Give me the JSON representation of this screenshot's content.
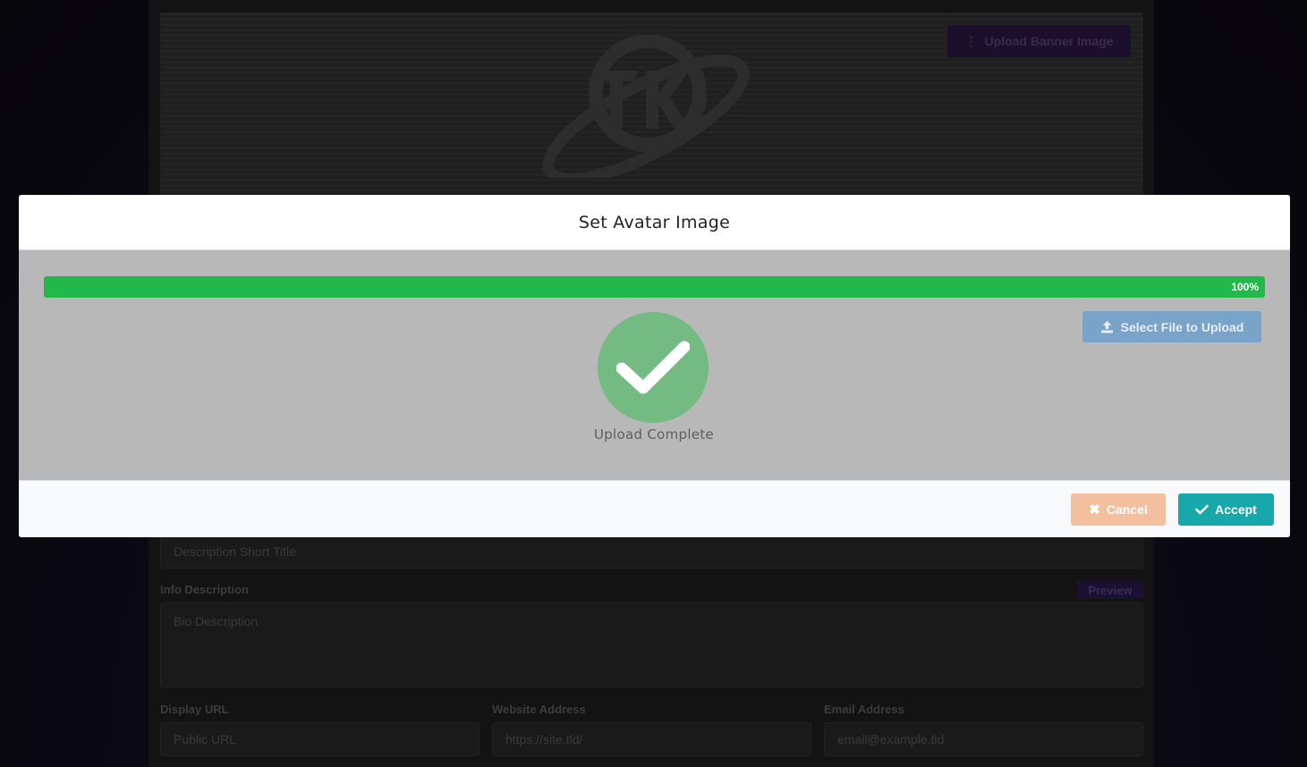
{
  "background_page": {
    "upload_banner_label": "Upload Banner Image",
    "short_title_placeholder": "Description Short Title",
    "info_description_label": "Info Description",
    "preview_label": "Preview",
    "bio_placeholder": "Bio Description",
    "display_url_label": "Display URL",
    "display_url_placeholder": "Public URL",
    "website_label": "Website Address",
    "website_placeholder": "https://site.tld/",
    "email_label": "Email Address",
    "email_placeholder": "email@example.tld"
  },
  "modal": {
    "title": "Set Avatar Image",
    "progress": {
      "value": 100,
      "text": "100%"
    },
    "select_file_label": "Select File to Upload",
    "status_text": "Upload Complete",
    "cancel_label": "Cancel",
    "accept_label": "Accept"
  },
  "colors": {
    "progress": "#23b84a",
    "accept": "#17a8ac",
    "cancel": "#f2bf9f",
    "select_file": "#7aa3c9",
    "success_circle": "#73ba83"
  },
  "icons": {
    "banner_button": "vertical-ellipsis-icon",
    "select_file": "upload-icon",
    "status": "check-circle-icon",
    "cancel": "close-icon",
    "accept": "check-icon"
  }
}
